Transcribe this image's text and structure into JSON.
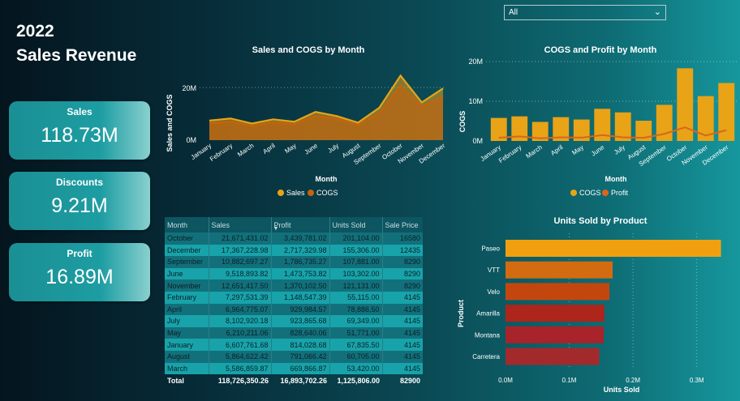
{
  "header": {
    "year": "2022",
    "title": "Sales Revenue"
  },
  "slicer": {
    "value": "All"
  },
  "kpis": [
    {
      "label": "Sales",
      "value": "118.73M"
    },
    {
      "label": "Discounts",
      "value": "9.21M"
    },
    {
      "label": "Profit",
      "value": "16.89M"
    }
  ],
  "chart_data": [
    {
      "type": "area",
      "title": "Sales and COGS by Month",
      "xlabel": "Month",
      "ylabel": "Sales and COGS",
      "yticks": [
        "0M",
        "20M"
      ],
      "ylim": [
        0,
        24
      ],
      "categories": [
        "January",
        "February",
        "March",
        "April",
        "May",
        "June",
        "July",
        "August",
        "September",
        "October",
        "November",
        "December"
      ],
      "series": [
        {
          "name": "Sales",
          "color": "#e8a317",
          "values": [
            6.6,
            7.3,
            5.6,
            7.0,
            6.2,
            9.5,
            8.1,
            5.9,
            10.9,
            21.7,
            12.7,
            17.4
          ]
        },
        {
          "name": "COGS",
          "color": "#c8630b",
          "values": [
            5.8,
            6.2,
            4.8,
            6.0,
            5.4,
            8.1,
            7.2,
            5.1,
            9.1,
            18.3,
            11.3,
            14.6
          ]
        }
      ],
      "legend": "bottom"
    },
    {
      "type": "bar",
      "title": "COGS and Profit by Month",
      "xlabel": "Month",
      "ylabel": "COGS",
      "yticks": [
        "0M",
        "10M",
        "20M"
      ],
      "ylim": [
        0,
        20
      ],
      "categories": [
        "January",
        "February",
        "March",
        "April",
        "May",
        "June",
        "July",
        "August",
        "September",
        "October",
        "November",
        "December"
      ],
      "series": [
        {
          "name": "COGS",
          "color": "#e8a317",
          "values": [
            5.8,
            6.2,
            4.8,
            6.0,
            5.4,
            8.1,
            7.2,
            5.1,
            9.1,
            18.3,
            11.3,
            14.6
          ]
        },
        {
          "name": "Profit",
          "color": "#d9661a",
          "values": [
            0.81,
            1.15,
            0.67,
            0.93,
            0.83,
            1.47,
            0.92,
            0.79,
            1.79,
            3.44,
            1.37,
            2.72
          ]
        }
      ],
      "legend": "bottom"
    },
    {
      "type": "bar",
      "orientation": "horizontal",
      "title": "Units Sold by Product",
      "xlabel": "Units Sold",
      "ylabel": "Product",
      "xticks": [
        "0.0M",
        "0.1M",
        "0.2M",
        "0.3M"
      ],
      "xlim": [
        0,
        0.35
      ],
      "categories": [
        "Paseo",
        "VTT",
        "Velo",
        "Amarilla",
        "Montana",
        "Carretera"
      ],
      "values": [
        0.338,
        0.168,
        0.163,
        0.155,
        0.154,
        0.147
      ],
      "colors": [
        "#f0a00f",
        "#d36b10",
        "#c4460f",
        "#ad251b",
        "#a8232a",
        "#a32a2c"
      ]
    }
  ],
  "table": {
    "columns": [
      "Month",
      "Sales",
      "Profit",
      "Units Sold",
      "Sale Price"
    ],
    "rows": [
      [
        "October",
        "21,671,431.02",
        "3,439,781.02",
        "201,104.00",
        "16580"
      ],
      [
        "December",
        "17,367,228.98",
        "2,717,329.98",
        "155,306.00",
        "12435"
      ],
      [
        "September",
        "10,882,697.27",
        "1,786,735.27",
        "107,881.00",
        "8290"
      ],
      [
        "June",
        "9,518,893.82",
        "1,473,753.82",
        "103,302.00",
        "8290"
      ],
      [
        "November",
        "12,651,417.50",
        "1,370,102.50",
        "121,131.00",
        "8290"
      ],
      [
        "February",
        "7,297,531.39",
        "1,148,547.39",
        "55,115.00",
        "4145"
      ],
      [
        "April",
        "6,964,775.07",
        "929,984.57",
        "78,886.50",
        "4145"
      ],
      [
        "July",
        "8,102,920.18",
        "923,865.68",
        "69,349.00",
        "4145"
      ],
      [
        "May",
        "6,210,211.06",
        "828,640.06",
        "51,771.00",
        "4145"
      ],
      [
        "January",
        "6,607,761.68",
        "814,028.68",
        "67,835.50",
        "4145"
      ],
      [
        "August",
        "5,864,622.42",
        "791,066.42",
        "60,705.00",
        "4145"
      ],
      [
        "March",
        "5,586,859.87",
        "669,866.87",
        "53,420.00",
        "4145"
      ]
    ],
    "total": [
      "Total",
      "118,726,350.26",
      "16,893,702.26",
      "1,125,806.00",
      "82900"
    ]
  }
}
